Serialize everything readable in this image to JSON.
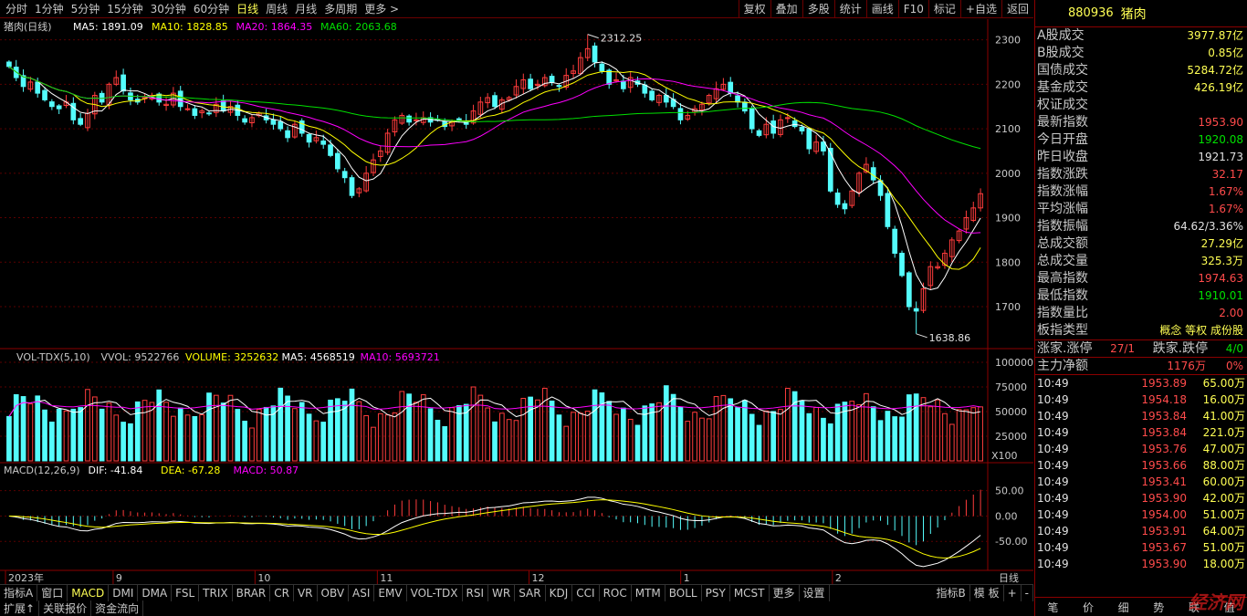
{
  "period_tabs": [
    "分时",
    "1分钟",
    "5分钟",
    "15分钟",
    "30分钟",
    "60分钟",
    "日线",
    "周线",
    "月线",
    "多周期",
    "更多 >"
  ],
  "active_period": "日线",
  "toolbar_right": [
    "复权",
    "叠加",
    "多股",
    "统计",
    "画线",
    "F10",
    "标记",
    "+自选",
    "返回"
  ],
  "chart_title": "猪肉(日线)",
  "ma_legend": [
    {
      "label": "MA5: 1891.09",
      "color": "#ffffff"
    },
    {
      "label": "MA10: 1828.85",
      "color": "#ffff00"
    },
    {
      "label": "MA20: 1864.35",
      "color": "#ff00ff"
    },
    {
      "label": "MA60: 2063.68",
      "color": "#00e000"
    }
  ],
  "price_axis": [
    "2300",
    "2200",
    "2100",
    "2000",
    "1900",
    "1800",
    "1700"
  ],
  "high_label": "2312.25",
  "low_label": "1638.86",
  "vol_legend": [
    {
      "label": "VOL-TDX(5,10)",
      "color": "#c8c8c8"
    },
    {
      "label": "VVOL: 9522766",
      "color": "#c8c8c8"
    },
    {
      "label": "VOLUME: 3252632",
      "color": "#ffff00"
    },
    {
      "label": "MA5: 4568519",
      "color": "#ffffff"
    },
    {
      "label": "MA10: 5693721",
      "color": "#ff00ff"
    }
  ],
  "vol_axis": [
    "100000",
    "75000",
    "50000",
    "25000"
  ],
  "vol_unit": "X100",
  "macd_legend": [
    {
      "label": "MACD(12,26,9)",
      "color": "#c8c8c8"
    },
    {
      "label": "DIF: -41.84",
      "color": "#ffffff"
    },
    {
      "label": "DEA: -67.28",
      "color": "#ffff00"
    },
    {
      "label": "MACD: 50.87",
      "color": "#ff00ff"
    }
  ],
  "macd_axis": [
    "50.00",
    "0.00",
    "-50.00"
  ],
  "date_axis": [
    "2023年",
    "9",
    "10",
    "11",
    "12",
    "1",
    "2"
  ],
  "date_btn": "日线",
  "indicator_tabs": [
    "指标A",
    "窗口",
    "MACD",
    "DMI",
    "DMA",
    "FSL",
    "TRIX",
    "BRAR",
    "CR",
    "VR",
    "OBV",
    "ASI",
    "EMV",
    "VOL-TDX",
    "RSI",
    "WR",
    "SAR",
    "KDJ",
    "CCI",
    "ROC",
    "MTM",
    "BOLL",
    "PSY",
    "MCST",
    "更多",
    "设置"
  ],
  "indicator_tabs_right": [
    "指标B",
    "模 板",
    "+",
    "-"
  ],
  "bottom_tabs": [
    "扩展↑",
    "关联报价",
    "资金流向"
  ],
  "panel_header": {
    "code": "880936",
    "name": "猪肉"
  },
  "stats": [
    {
      "label": "A股成交",
      "value": "3977.87亿",
      "color": "#ffff54"
    },
    {
      "label": "B股成交",
      "value": "0.85亿",
      "color": "#ffff54"
    },
    {
      "label": "国债成交",
      "value": "5284.72亿",
      "color": "#ffff54"
    },
    {
      "label": "基金成交",
      "value": "426.19亿",
      "color": "#ffff54"
    },
    {
      "label": "权证成交",
      "value": "",
      "color": "#ffff54"
    },
    {
      "label": "最新指数",
      "value": "1953.90",
      "color": "#ff4b4b"
    },
    {
      "label": "今日开盘",
      "value": "1920.08",
      "color": "#00e000"
    },
    {
      "label": "昨日收盘",
      "value": "1921.73",
      "color": "#e0e0e0"
    },
    {
      "label": "指数涨跌",
      "value": "32.17",
      "color": "#ff4b4b"
    },
    {
      "label": "指数涨幅",
      "value": "1.67%",
      "color": "#ff4b4b"
    },
    {
      "label": "平均涨幅",
      "value": "1.67%",
      "color": "#ff4b4b"
    },
    {
      "label": "指数振幅",
      "value": "64.62/3.36%",
      "color": "#e0e0e0"
    },
    {
      "label": "总成交额",
      "value": "27.29亿",
      "color": "#ffff54"
    },
    {
      "label": "总成交量",
      "value": "325.3万",
      "color": "#ffff54"
    },
    {
      "label": "最高指数",
      "value": "1974.63",
      "color": "#ff4b4b"
    },
    {
      "label": "最低指数",
      "value": "1910.01",
      "color": "#00e000"
    },
    {
      "label": "指数量比",
      "value": "2.00",
      "color": "#ff4b4b"
    },
    {
      "label": "板指类型",
      "value": "概念 等权 成份股",
      "color": "#ffff54"
    }
  ],
  "updown": {
    "l1": "涨家.涨停",
    "v1": "27/1",
    "l2": "跌家.跌停",
    "v2": "4/0"
  },
  "mainflow": {
    "label": "主力净额",
    "value": "1176万",
    "pct": "0%"
  },
  "ticks": [
    {
      "t": "10:49",
      "p": "1953.89",
      "v": "65.00万"
    },
    {
      "t": "10:49",
      "p": "1954.18",
      "v": "16.00万"
    },
    {
      "t": "10:49",
      "p": "1953.84",
      "v": "41.00万"
    },
    {
      "t": "10:49",
      "p": "1953.84",
      "v": "221.0万"
    },
    {
      "t": "10:49",
      "p": "1953.76",
      "v": "47.00万"
    },
    {
      "t": "10:49",
      "p": "1953.66",
      "v": "88.00万"
    },
    {
      "t": "10:49",
      "p": "1953.41",
      "v": "60.00万"
    },
    {
      "t": "10:49",
      "p": "1953.90",
      "v": "42.00万"
    },
    {
      "t": "10:49",
      "p": "1954.00",
      "v": "51.00万"
    },
    {
      "t": "10:49",
      "p": "1953.91",
      "v": "64.00万"
    },
    {
      "t": "10:49",
      "p": "1953.67",
      "v": "51.00万"
    },
    {
      "t": "10:49",
      "p": "1953.90",
      "v": "18.00万"
    }
  ],
  "panel_tabs": [
    "笔",
    "价",
    "细",
    "势",
    "联",
    "值"
  ],
  "watermark": "经济网",
  "chart_data": {
    "type": "candlestick",
    "title": "猪肉(日线)",
    "ylim": [
      1620,
      2330
    ],
    "closes": [
      2240,
      2215,
      2195,
      2205,
      2180,
      2165,
      2150,
      2145,
      2160,
      2120,
      2110,
      2135,
      2175,
      2160,
      2200,
      2215,
      2185,
      2165,
      2160,
      2170,
      2175,
      2160,
      2155,
      2180,
      2150,
      2145,
      2130,
      2140,
      2135,
      2155,
      2140,
      2150,
      2130,
      2115,
      2125,
      2135,
      2120,
      2110,
      2100,
      2080,
      2110,
      2090,
      2070,
      2080,
      2065,
      2040,
      2010,
      1990,
      1950,
      1965,
      2000,
      2030,
      2050,
      2090,
      2120,
      2130,
      2115,
      2120,
      2125,
      2115,
      2120,
      2105,
      2115,
      2120,
      2110,
      2140,
      2160,
      2170,
      2150,
      2165,
      2170,
      2195,
      2210,
      2190,
      2200,
      2215,
      2205,
      2195,
      2220,
      2230,
      2260,
      2280,
      2250,
      2230,
      2200,
      2210,
      2190,
      2215,
      2200,
      2180,
      2165,
      2175,
      2160,
      2150,
      2120,
      2130,
      2145,
      2155,
      2175,
      2190,
      2200,
      2180,
      2160,
      2140,
      2100,
      2085,
      2110,
      2090,
      2120,
      2125,
      2105,
      2095,
      2055,
      2070,
      2050,
      1960,
      1930,
      1920,
      1960,
      2000,
      2020,
      1985,
      1950,
      1880,
      1820,
      1770,
      1700,
      1690,
      1740,
      1790,
      1790,
      1820,
      1850,
      1870,
      1900,
      1922,
      1954
    ]
  }
}
